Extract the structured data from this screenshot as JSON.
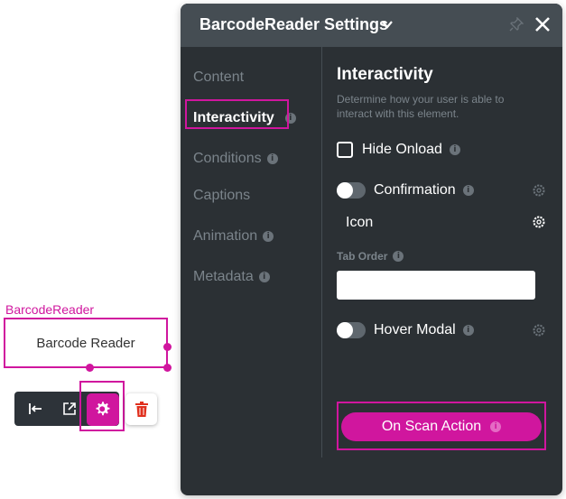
{
  "component": {
    "name_label": "BarcodeReader",
    "box_text": "Barcode Reader"
  },
  "toolbar": {
    "icons": [
      "move-left-icon",
      "open-external-icon",
      "gear-icon",
      "trash-icon"
    ]
  },
  "panel": {
    "title": "BarcodeReader Settings",
    "nav": [
      {
        "label": "Content",
        "info": false
      },
      {
        "label": "Interactivity",
        "info": true,
        "active": true
      },
      {
        "label": "Conditions",
        "info": true
      },
      {
        "label": "Captions",
        "info": false
      },
      {
        "label": "Animation",
        "info": true
      },
      {
        "label": "Metadata",
        "info": true
      }
    ],
    "section": {
      "title": "Interactivity",
      "description": "Determine how your user is able to interact with this element.",
      "hide_onload": "Hide Onload",
      "confirmation": "Confirmation",
      "icon": "Icon",
      "tab_order_label": "Tab Order",
      "tab_order_value": "",
      "hover_modal": "Hover Modal",
      "scan_action": "On Scan Action"
    }
  },
  "info_glyph": "i",
  "colors": {
    "accent": "#d0169e",
    "panel_bg": "#2b3034",
    "header_bg": "#454d53",
    "muted_text": "#7b848b"
  }
}
